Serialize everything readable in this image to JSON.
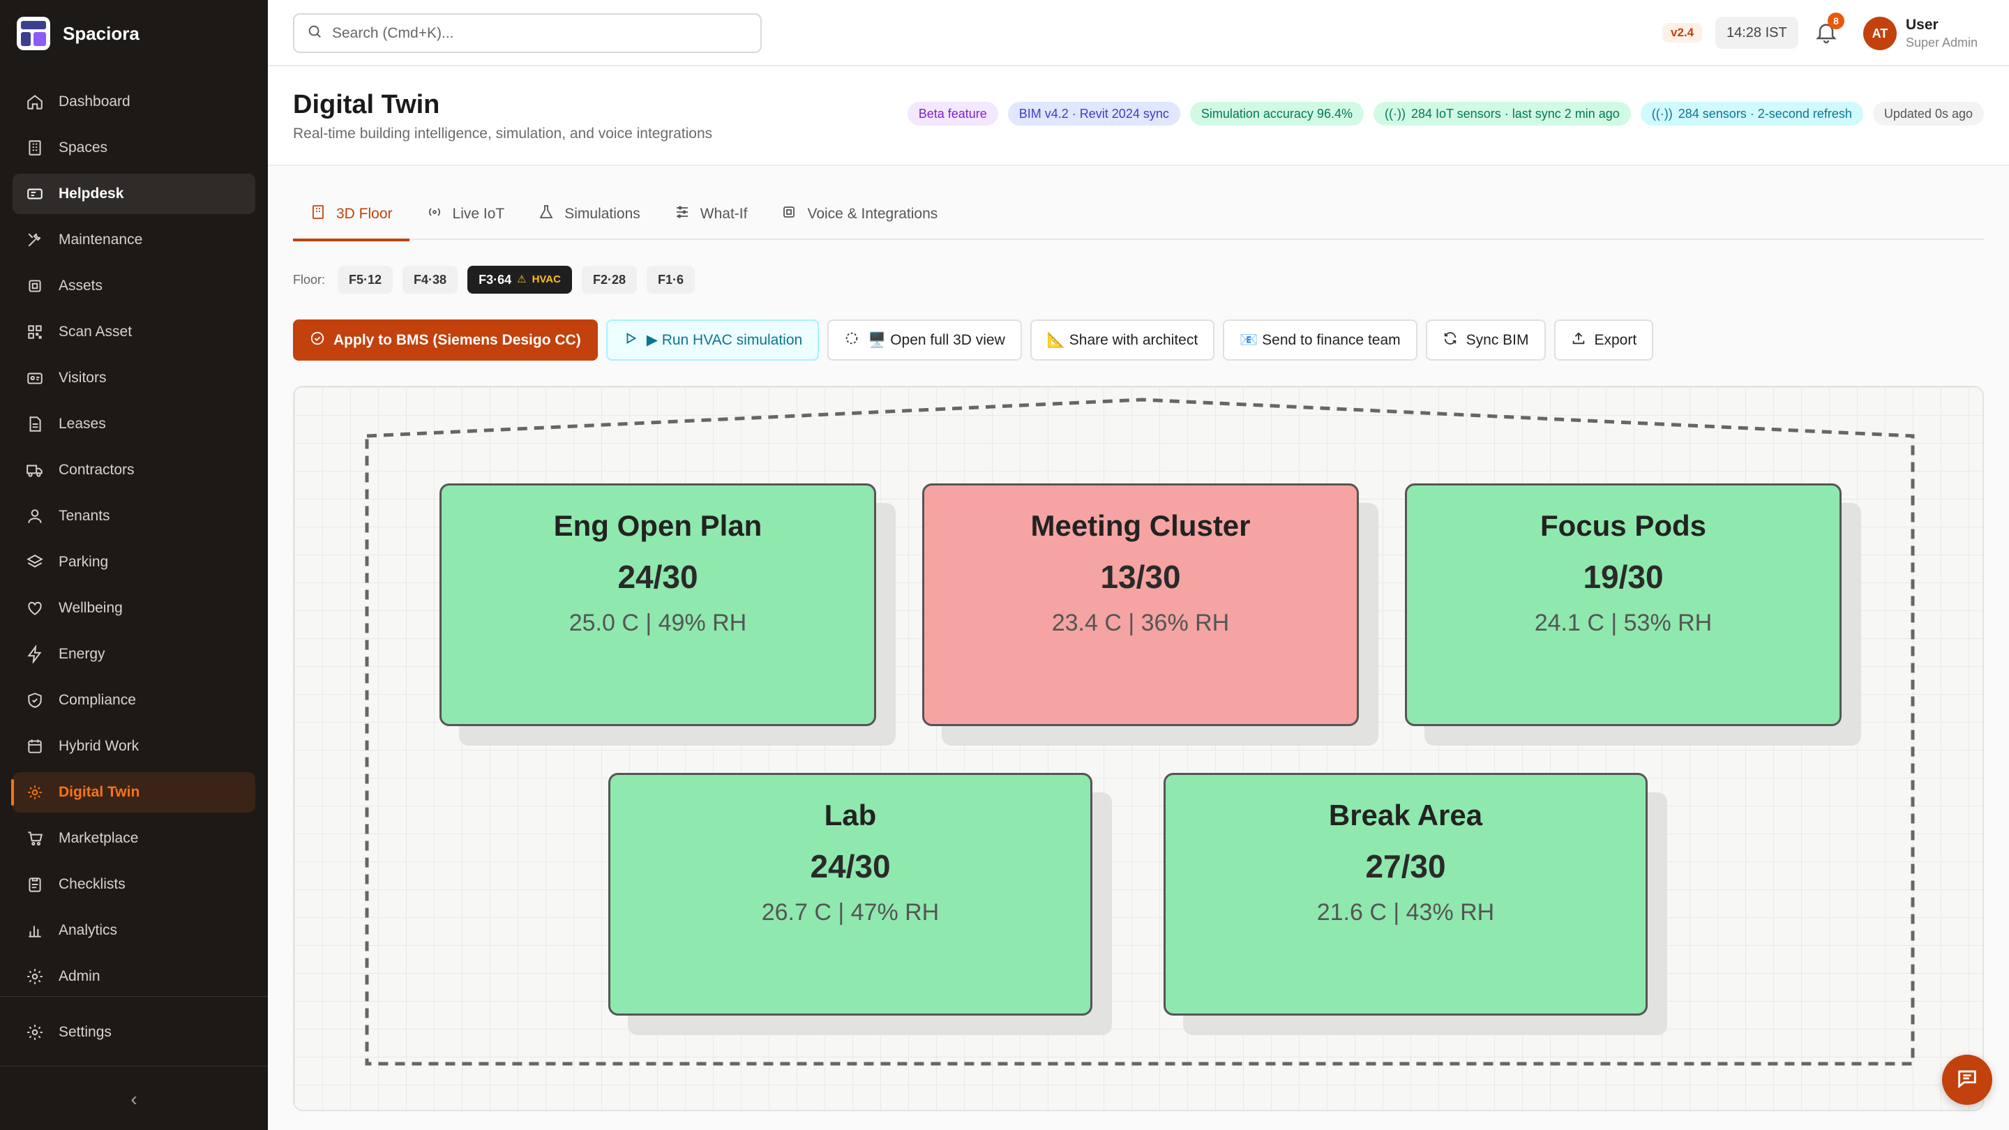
{
  "app": {
    "name": "Spaciora"
  },
  "sidebar": {
    "items": [
      {
        "label": "Dashboard",
        "icon": "home-icon"
      },
      {
        "label": "Spaces",
        "icon": "building-icon"
      },
      {
        "label": "Helpdesk",
        "icon": "ticket-icon"
      },
      {
        "label": "Maintenance",
        "icon": "wrench-icon"
      },
      {
        "label": "Assets",
        "icon": "cube-icon"
      },
      {
        "label": "Scan Asset",
        "icon": "qr-icon"
      },
      {
        "label": "Visitors",
        "icon": "visitors-icon"
      },
      {
        "label": "Leases",
        "icon": "document-icon"
      },
      {
        "label": "Contractors",
        "icon": "truck-icon"
      },
      {
        "label": "Tenants",
        "icon": "user-icon"
      },
      {
        "label": "Parking",
        "icon": "layers-icon"
      },
      {
        "label": "Wellbeing",
        "icon": "heart-icon"
      },
      {
        "label": "Energy",
        "icon": "bolt-icon"
      },
      {
        "label": "Compliance",
        "icon": "shield-icon"
      },
      {
        "label": "Hybrid Work",
        "icon": "calendar-icon"
      },
      {
        "label": "Digital Twin",
        "icon": "twin-icon"
      },
      {
        "label": "Marketplace",
        "icon": "cart-icon"
      },
      {
        "label": "Checklists",
        "icon": "clipboard-icon"
      },
      {
        "label": "Analytics",
        "icon": "bar-chart-icon"
      },
      {
        "label": "Admin",
        "icon": "gear-icon"
      }
    ],
    "settings_label": "Settings",
    "hover_index": 2,
    "active_index": 15
  },
  "topbar": {
    "search_placeholder": "Search (Cmd+K)...",
    "version": "v2.4",
    "time": "14:28 IST",
    "notification_count": "8",
    "user_initials": "AT",
    "user_name": "User",
    "user_role": "Super Admin"
  },
  "header": {
    "title": "Digital Twin",
    "subtitle": "Real-time building intelligence, simulation, and voice integrations",
    "pills": {
      "beta": "Beta feature",
      "bim": "BIM v4.2 · Revit 2024 sync",
      "accuracy": "Simulation accuracy 96.4%",
      "iot": "284 IoT sensors · last sync 2 min ago",
      "sensors": "284 sensors · 2-second refresh",
      "updated": "Updated 0s ago"
    }
  },
  "tabs": [
    {
      "label": "3D Floor",
      "icon": "building-icon"
    },
    {
      "label": "Live IoT",
      "icon": "broadcast-icon"
    },
    {
      "label": "Simulations",
      "icon": "flask-icon"
    },
    {
      "label": "What-If",
      "icon": "sliders-icon"
    },
    {
      "label": "Voice & Integrations",
      "icon": "chip-icon"
    }
  ],
  "floors": {
    "label": "Floor:",
    "chips": [
      "F5·12",
      "F4·38",
      "F3·64",
      "F2·28",
      "F1·6"
    ],
    "active_warning": "HVAC"
  },
  "actions": {
    "apply": "Apply to BMS (Siemens Desigo CC)",
    "run": "▶ Run HVAC simulation",
    "open": "🖥️ Open full 3D view",
    "share": "📐 Share with architect",
    "send": "📧 Send to finance team",
    "sync": "Sync BIM",
    "export": "Export"
  },
  "zones": [
    {
      "name": "Eng Open Plan",
      "occupancy": "24/30",
      "env": "25.0 C | 49% RH",
      "status": "ok",
      "status_color": "#8fe8ae"
    },
    {
      "name": "Meeting Cluster",
      "occupancy": "13/30",
      "env": "23.4 C | 36% RH",
      "status": "alert",
      "status_color": "#f5a3a3"
    },
    {
      "name": "Focus Pods",
      "occupancy": "19/30",
      "env": "24.1 C | 53% RH",
      "status": "ok",
      "status_color": "#8fe8ae"
    },
    {
      "name": "Lab",
      "occupancy": "24/30",
      "env": "26.7 C | 47% RH",
      "status": "ok",
      "status_color": "#8fe8ae"
    },
    {
      "name": "Break Area",
      "occupancy": "27/30",
      "env": "21.6 C | 43% RH",
      "status": "ok",
      "status_color": "#8fe8ae"
    }
  ],
  "colors": {
    "accent": "#c2410c",
    "sidebar_bg": "#1c1917"
  }
}
